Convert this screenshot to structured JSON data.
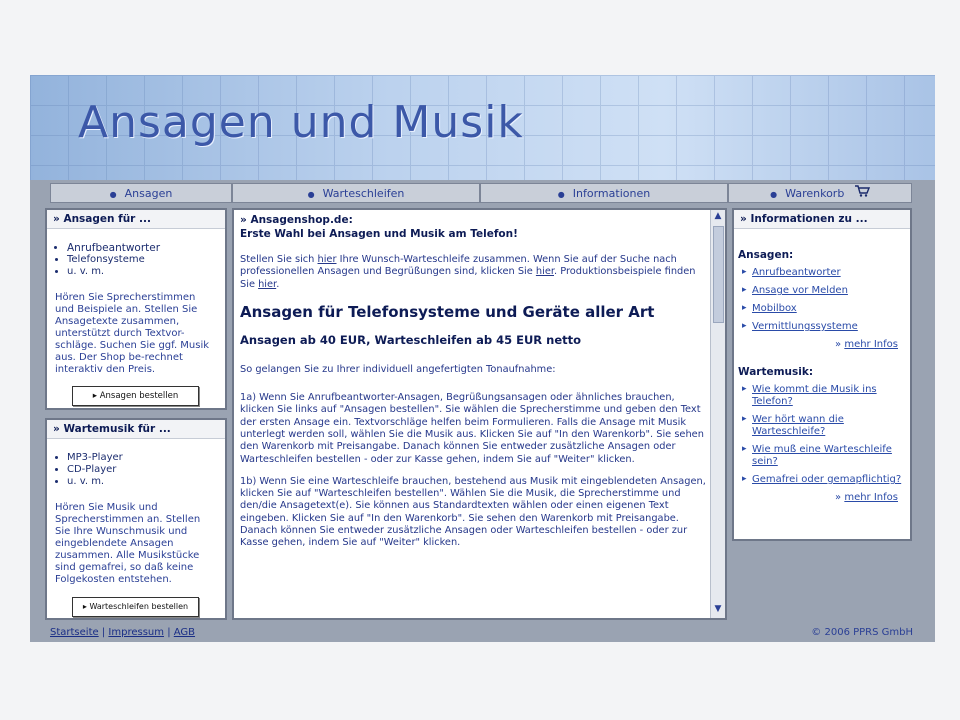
{
  "banner": {
    "title": "Ansagen und Musik"
  },
  "nav": {
    "items": [
      {
        "label": "Ansagen"
      },
      {
        "label": "Warteschleifen"
      },
      {
        "label": "Informationen"
      },
      {
        "label": "Warenkorb"
      }
    ]
  },
  "left": {
    "box1": {
      "heading": "» Ansagen für ...",
      "items": [
        "Anrufbeantworter",
        "Telefonsysteme",
        "u. v. m."
      ],
      "text": "Hören Sie Sprecherstimmen und Beispiele an. Stellen Sie Ansagetexte zusammen, unterstützt durch Textvor-schläge. Suchen Sie ggf. Musik aus. Der Shop be-rechnet interaktiv den Preis.",
      "button": "Ansagen bestellen"
    },
    "box2": {
      "heading": "» Wartemusik für ...",
      "items": [
        "MP3-Player",
        "CD-Player",
        "u. v. m."
      ],
      "text": "Hören Sie Musik und Sprecherstimmen an. Stellen Sie Ihre Wunschmusik und eingeblendete Ansagen zusammen. Alle Musikstücke sind gemafrei, so daß keine Folgekosten entstehen.",
      "button": "Warteschleifen bestellen"
    }
  },
  "main": {
    "heading": "» Ansagenshop.de:",
    "subheading": "Erste Wahl bei Ansagen und Musik am Telefon!",
    "intro_1": "Stellen Sie sich ",
    "intro_link1": "hier",
    "intro_2": " Ihre Wunsch-Warteschleife zusammen. Wenn Sie auf der Suche nach professionellen Ansagen und Begrüßungen sind, klicken Sie ",
    "intro_link2": "hier",
    "intro_3": ". Produktionsbeispiele finden Sie ",
    "intro_link3": "hier",
    "intro_4": ".",
    "title": "Ansagen für Telefonsysteme und Geräte aller Art",
    "price": "Ansagen ab 40 EUR, Warteschleifen ab 45 EUR netto",
    "lead": "So gelangen Sie zu Ihrer individuell angefertigten Tonaufnahme:",
    "step_1a": "1a) Wenn Sie Anrufbeantworter-Ansagen, Begrüßungsansagen oder ähnliches brauchen, klicken Sie links auf \"Ansagen bestellen\". Sie wählen die Sprecherstimme und geben den Text der ersten Ansage ein. Textvorschläge helfen beim Formulieren. Falls die Ansage mit Musik unterlegt werden soll, wählen Sie die Musik aus. Klicken Sie auf \"In den Warenkorb\". Sie sehen den Warenkorb mit Preisangabe. Danach können Sie entweder zusätzliche Ansagen oder Warteschleifen bestellen - oder zur Kasse gehen, indem Sie auf \"Weiter\" klicken.",
    "step_1b": "1b) Wenn Sie eine Warteschleife brauchen, bestehend aus Musik mit eingeblendeten Ansagen, klicken Sie auf \"Warteschleifen bestellen\". Wählen Sie die Musik, die Sprecherstimme und den/die Ansagetext(e). Sie können aus Standardtexten wählen oder einen eigenen Text eingeben. Klicken Sie auf \"In den Warenkorb\". Sie sehen den Warenkorb mit Preisangabe. Danach können Sie entweder zusätzliche Ansagen oder Warteschleifen bestellen - oder zur Kasse gehen, indem Sie auf \"Weiter\" klicken."
  },
  "right": {
    "heading": "» Informationen zu ...",
    "sec1_title": "Ansagen:",
    "sec1_links": [
      "Anrufbeantworter",
      "Ansage vor Melden",
      "Mobilbox",
      "Vermittlungssysteme"
    ],
    "sec1_more": "mehr Infos",
    "sec2_title": "Wartemusik:",
    "sec2_links": [
      "Wie kommt die Musik ins Telefon?",
      "Wer hört wann die Warteschleife?",
      "Wie muß eine Warteschleife sein?",
      "Gemafrei oder gemapflichtig?"
    ],
    "sec2_more": "mehr Infos"
  },
  "footer": {
    "links": [
      "Startseite",
      "Impressum",
      "AGB"
    ],
    "sep": "|",
    "copyright": "© 2006 PPRS GmbH"
  },
  "icons": {
    "nav_bullet": "bullet-icon",
    "cart": "cart-icon",
    "arrow": "arrow-right-icon"
  }
}
